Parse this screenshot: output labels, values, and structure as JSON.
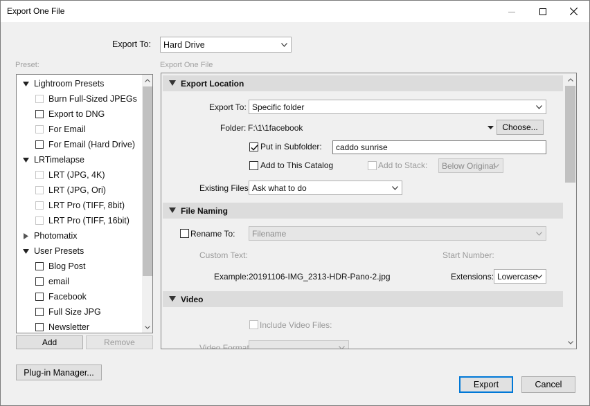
{
  "window": {
    "title": "Export One File"
  },
  "export_to": {
    "label": "Export To:",
    "value": "Hard Drive"
  },
  "presets": {
    "caption": "Preset:",
    "items": [
      {
        "type": "group",
        "label": "Lightroom Presets",
        "expanded": true
      },
      {
        "type": "item",
        "label": "Burn Full-Sized JPEGs",
        "faint": true
      },
      {
        "type": "item",
        "label": "Export to DNG",
        "faint": false
      },
      {
        "type": "item",
        "label": "For Email",
        "faint": true
      },
      {
        "type": "item",
        "label": "For Email (Hard Drive)",
        "faint": false
      },
      {
        "type": "group",
        "label": "LRTimelapse",
        "expanded": true
      },
      {
        "type": "item",
        "label": "LRT (JPG, 4K)",
        "faint": true
      },
      {
        "type": "item",
        "label": "LRT (JPG, Ori)",
        "faint": true
      },
      {
        "type": "item",
        "label": "LRT Pro (TIFF, 8bit)",
        "faint": true
      },
      {
        "type": "item",
        "label": "LRT Pro (TIFF, 16bit)",
        "faint": true
      },
      {
        "type": "group",
        "label": "Photomatix",
        "expanded": false
      },
      {
        "type": "group",
        "label": "User Presets",
        "expanded": true
      },
      {
        "type": "item",
        "label": "Blog Post",
        "faint": false
      },
      {
        "type": "item",
        "label": "email",
        "faint": false
      },
      {
        "type": "item",
        "label": "Facebook",
        "faint": false
      },
      {
        "type": "item",
        "label": "Full Size JPG",
        "faint": false
      },
      {
        "type": "item",
        "label": "Newsletter",
        "faint": false
      }
    ],
    "add_label": "Add",
    "remove_label": "Remove"
  },
  "settings": {
    "caption": "Export One File",
    "export_location": {
      "header": "Export Location",
      "export_to_label": "Export To:",
      "export_to_value": "Specific folder",
      "folder_label": "Folder:",
      "folder_value": "F:\\1\\1facebook",
      "choose_label": "Choose...",
      "subfolder_label": "Put in Subfolder:",
      "subfolder_checked": true,
      "subfolder_value": "caddo sunrise",
      "add_catalog_label": "Add to This Catalog",
      "add_stack_label": "Add to Stack:",
      "stack_position": "Below Original",
      "existing_files_label": "Existing Files:",
      "existing_files_value": "Ask what to do"
    },
    "file_naming": {
      "header": "File Naming",
      "rename_label": "Rename To:",
      "rename_value": "Filename",
      "custom_text_label": "Custom Text:",
      "start_number_label": "Start Number:",
      "example_label": "Example:",
      "example_value": "20191106-IMG_2313-HDR-Pano-2.jpg",
      "extensions_label": "Extensions:",
      "extensions_value": "Lowercase"
    },
    "video": {
      "header": "Video",
      "include_label": "Include Video Files:",
      "format_label": "Video Format:"
    }
  },
  "footer": {
    "plugin_manager_label": "Plug-in Manager...",
    "export_label": "Export",
    "cancel_label": "Cancel"
  }
}
